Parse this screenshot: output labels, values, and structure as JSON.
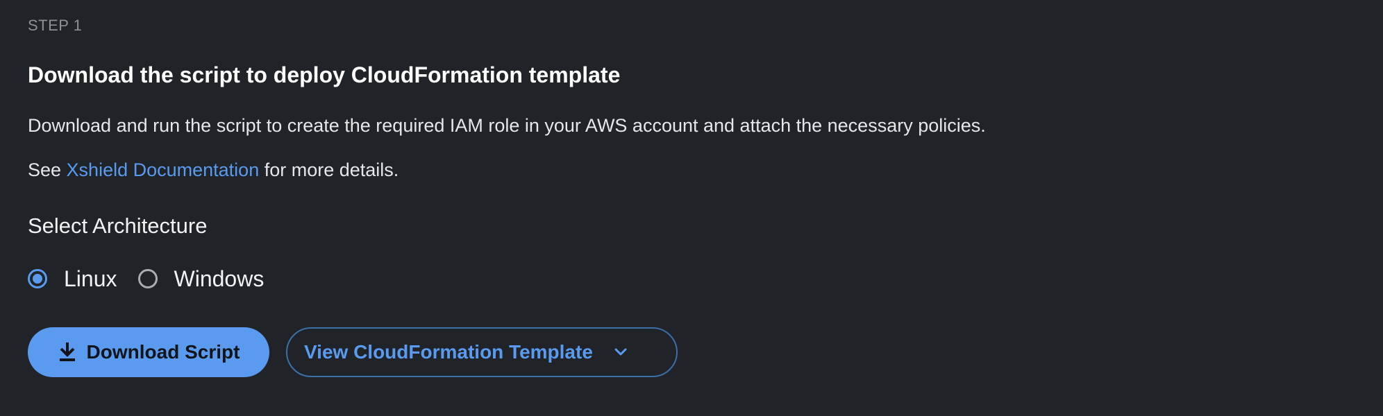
{
  "step": {
    "label": "STEP 1"
  },
  "title": "Download the script to deploy CloudFormation template",
  "description": "Download and run the script to create the required IAM role in your AWS account and attach the necessary policies.",
  "docs_line": {
    "prefix": "See ",
    "link_text": "Xshield Documentation",
    "suffix": " for more details."
  },
  "architecture": {
    "heading": "Select Architecture",
    "options": [
      {
        "label": "Linux",
        "selected": true
      },
      {
        "label": "Windows",
        "selected": false
      }
    ]
  },
  "actions": {
    "download_label": "Download Script",
    "view_template_label": "View CloudFormation Template"
  },
  "icons": {
    "download": "download-icon",
    "chevron": "chevron-down-icon"
  },
  "colors": {
    "background": "#202328",
    "accent": "#5a9bf0",
    "muted_text": "#8d9096",
    "outline_border": "#3d6fa8"
  }
}
